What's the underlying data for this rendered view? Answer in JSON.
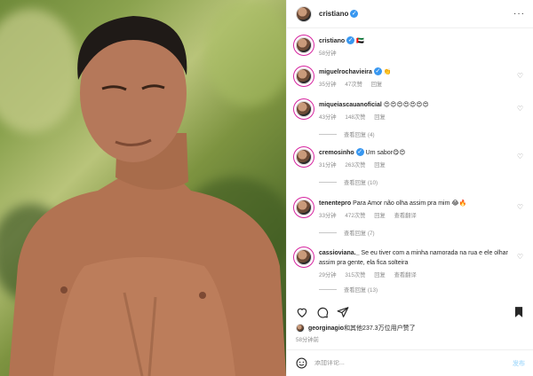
{
  "header": {
    "username": "cristiano",
    "more_label": "···"
  },
  "caption": {
    "username": "cristiano",
    "text": "🇦🇪",
    "time": "58分钟"
  },
  "comments": [
    {
      "username": "miguelrochavieira",
      "verified": true,
      "text": "👏",
      "time": "35分钟",
      "likes": "47次赞",
      "reply": "回复"
    },
    {
      "username": "miqueiascauanoficial",
      "verified": false,
      "text": "😍😍😍😍😍😍😍",
      "time": "43分钟",
      "likes": "148次赞",
      "reply": "回复",
      "view_replies": "查看回复 (4)"
    },
    {
      "username": "cremosinho",
      "verified": true,
      "text": "Um sabor😋😍",
      "time": "31分钟",
      "likes": "263次赞",
      "reply": "回复",
      "view_replies": "查看回复 (10)"
    },
    {
      "username": "tenentepro",
      "verified": false,
      "text": "Para Amor não olha assim pra mim 😂🔥",
      "time": "33分钟",
      "likes": "472次赞",
      "reply": "回复",
      "translate": "查看翻译",
      "view_replies": "查看回复 (7)"
    },
    {
      "username": "cassioviana._",
      "verified": false,
      "text": "Se eu tiver com a minha namorada na rua e ele olhar assim pra gente, ela fica solteira",
      "time": "29分钟",
      "likes": "315次赞",
      "reply": "回复",
      "translate": "查看翻译",
      "view_replies": "查看回复 (13)"
    }
  ],
  "likes": {
    "user": "georginagio",
    "rest": "和其他237.3万位用户赞了"
  },
  "timestamp": "58分钟前",
  "composer": {
    "placeholder": "添加评论...",
    "post_label": "发布"
  },
  "icons": {
    "like": "heart-icon",
    "comment": "comment-icon",
    "share": "share-icon",
    "save": "bookmark-icon",
    "emoji": "emoji-icon"
  },
  "colors": {
    "verified": "#3897f0",
    "muted": "#8e8e8e",
    "post_disabled": "#b2dffc"
  }
}
